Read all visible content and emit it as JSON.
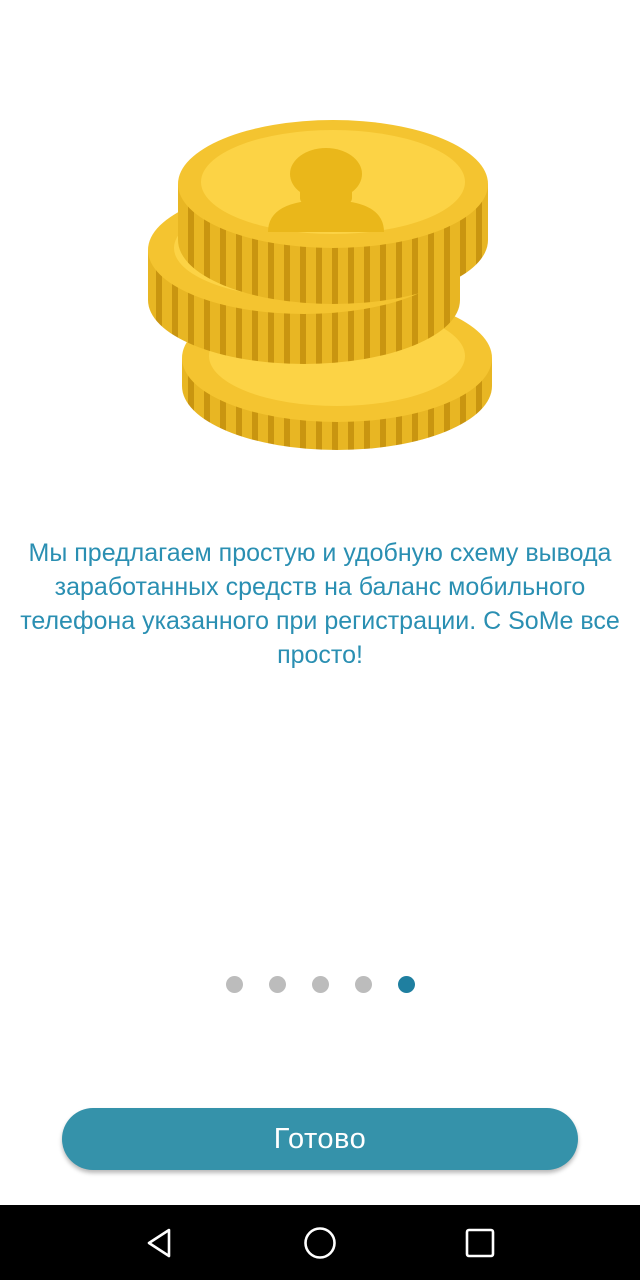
{
  "illustration": {
    "icon": "coins-stack-icon",
    "colors": {
      "face": "#fcd345",
      "rim": "#f4c430",
      "edge": "#e8b623",
      "groove": "#c99510",
      "emblem": "#eab71a"
    }
  },
  "onboarding": {
    "description": "Мы предлагаем простую и удобную схему вывода заработанных средств на баланс мобильного телефона указанного при регистрации. С SoMe все просто!",
    "page_indicator": {
      "total": 5,
      "current": 5
    }
  },
  "actions": {
    "done_label": "Готово"
  },
  "navigation_bar": {
    "icons": [
      "back-icon",
      "home-icon",
      "recents-icon"
    ]
  },
  "colors": {
    "text_accent": "#2a8fb2",
    "button": "#3592aa",
    "dot_active": "#1f7fa0",
    "dot_inactive": "#bcbcbc",
    "nav_background": "#000000"
  }
}
